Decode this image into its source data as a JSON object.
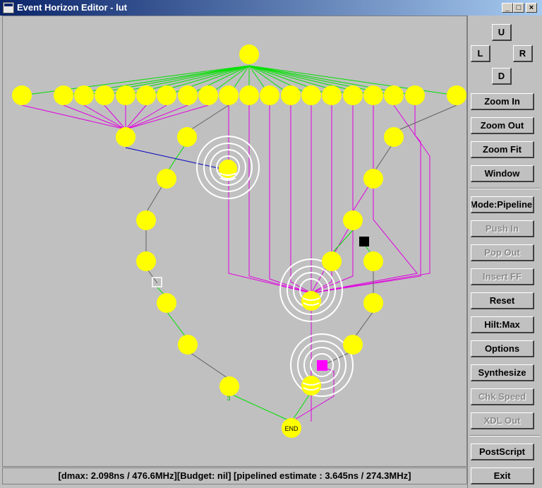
{
  "window": {
    "title": "Event Horizon Editor - lut",
    "minimize": "_",
    "maximize": "□",
    "close": "×"
  },
  "direction": {
    "up": "U",
    "left": "L",
    "right": "R",
    "down": "D"
  },
  "buttons": {
    "zoom_in": "Zoom In",
    "zoom_out": "Zoom Out",
    "zoom_fit": "Zoom Fit",
    "window": "Window",
    "mode": "Mode:Pipeline",
    "push_in": "Push In",
    "pop_out": "Pop Out",
    "insert_ff": "Insert FF",
    "reset": "Reset",
    "hilt": "Hilt:Max",
    "options": "Options",
    "synthesize": "Synthesize",
    "chk_speed": "Chk Speed",
    "xdl_out": "XDL Out",
    "postscript": "PostScript",
    "exit": "Exit"
  },
  "graph": {
    "end_label": "END",
    "edge_label": "3"
  },
  "colors": {
    "node": "#ffff00",
    "edge_green": "#00e000",
    "edge_magenta": "#e000e0",
    "edge_blue": "#0000c0",
    "edge_gray": "#606060",
    "ring": "#ffffff",
    "register": "#ff00ff"
  },
  "status": {
    "text": "[dmax:  2.098ns / 476.6MHz][Budget: nil] [pipelined estimate :  3.645ns / 274.3MHz]"
  }
}
